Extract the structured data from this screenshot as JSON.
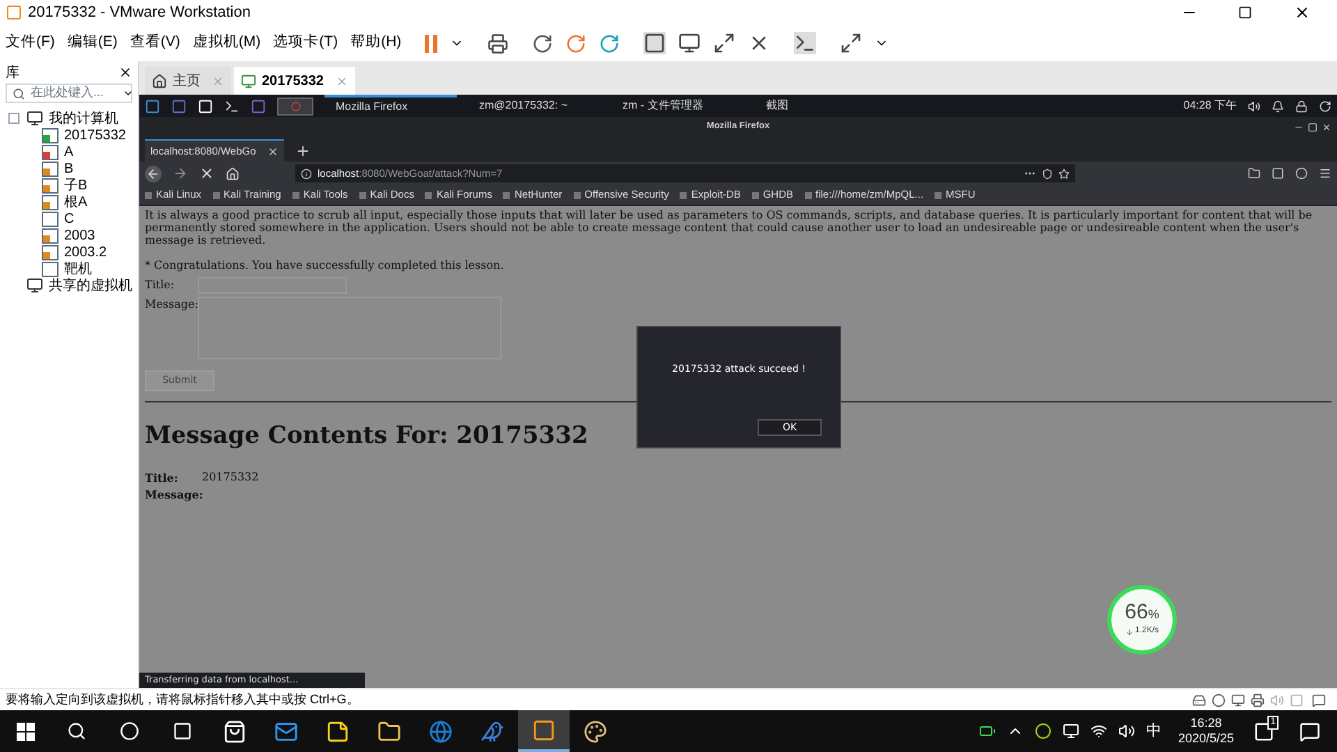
{
  "window": {
    "title": "20175332 - VMware Workstation"
  },
  "menu": [
    "文件(F)",
    "编辑(E)",
    "查看(V)",
    "虚拟机(M)",
    "选项卡(T)",
    "帮助(H)"
  ],
  "library": {
    "title": "库",
    "search_placeholder": "在此处键入...",
    "tree": [
      {
        "label": "我的计算机",
        "children": [
          {
            "label": "20175332",
            "kind": "running"
          },
          {
            "label": "A",
            "kind": "error"
          },
          {
            "label": "B",
            "kind": "paused"
          },
          {
            "label": "子B",
            "kind": "paused"
          },
          {
            "label": "根A",
            "kind": "paused"
          },
          {
            "label": "C",
            "kind": "off"
          },
          {
            "label": "2003",
            "kind": "paused"
          },
          {
            "label": "2003.2",
            "kind": "paused"
          },
          {
            "label": "靶机",
            "kind": "off"
          }
        ]
      },
      {
        "label": "共享的虚拟机"
      }
    ]
  },
  "vm_tabs": [
    {
      "label": "主页",
      "kind": "home",
      "selected": false
    },
    {
      "label": "20175332",
      "kind": "vm",
      "selected": true
    }
  ],
  "kali_panel": {
    "tasks": [
      {
        "label": "Mozilla Firefox",
        "selected": true
      },
      {
        "label": "zm@20175332: ~",
        "selected": false
      },
      {
        "label": "zm - 文件管理器",
        "selected": false
      },
      {
        "label": "截图",
        "selected": false
      }
    ],
    "clock": "04:28 下午"
  },
  "firefox": {
    "title": "Mozilla Firefox",
    "tab": "localhost:8080/WebGo",
    "url_host": "localhost",
    "url_path": ":8080/WebGoat/attack?Num=7",
    "bookmarks": [
      "Kali Linux",
      "Kali Training",
      "Kali Tools",
      "Kali Docs",
      "Kali Forums",
      "NetHunter",
      "Offensive Security",
      "Exploit-DB",
      "GHDB",
      "file:///home/zm/MpQL...",
      "MSFU"
    ],
    "status": "Transferring data from localhost..."
  },
  "page": {
    "intro": "It is always a good practice to scrub all input, especially those inputs that will later be used as parameters to OS commands, scripts, and database queries. It is particularly important for content that will be permanently stored somewhere in the application. Users should not be able to create message content that could cause another user to load an undesireable page or undesireable content when the user's message is retrieved.",
    "congrats": "* Congratulations. You have successfully completed this lesson.",
    "title_label": "Title:",
    "message_label": "Message:",
    "submit": "Submit",
    "heading": "Message Contents For: 20175332",
    "result_title_label": "Title:",
    "result_title": "20175332",
    "result_message_label": "Message:"
  },
  "dialog": {
    "message": "20175332 attack succeed !",
    "ok": "OK"
  },
  "network_widget": {
    "percent": "66",
    "unit": "%",
    "speed": "1.2K/s"
  },
  "status_hint": "要将输入定向到该虚拟机，请将鼠标指针移入其中或按 Ctrl+G。",
  "taskbar": {
    "apps": [
      {
        "kind": "store",
        "selected": false
      },
      {
        "kind": "mail",
        "selected": false
      },
      {
        "kind": "notes",
        "selected": false
      },
      {
        "kind": "folder",
        "selected": false
      },
      {
        "kind": "edge",
        "selected": false
      },
      {
        "kind": "bird",
        "selected": false
      },
      {
        "kind": "vmware",
        "selected": true
      },
      {
        "kind": "paint",
        "selected": false
      }
    ],
    "ime": "中",
    "time": "16:28",
    "date": "2020/5/25",
    "notification_count": "1"
  }
}
